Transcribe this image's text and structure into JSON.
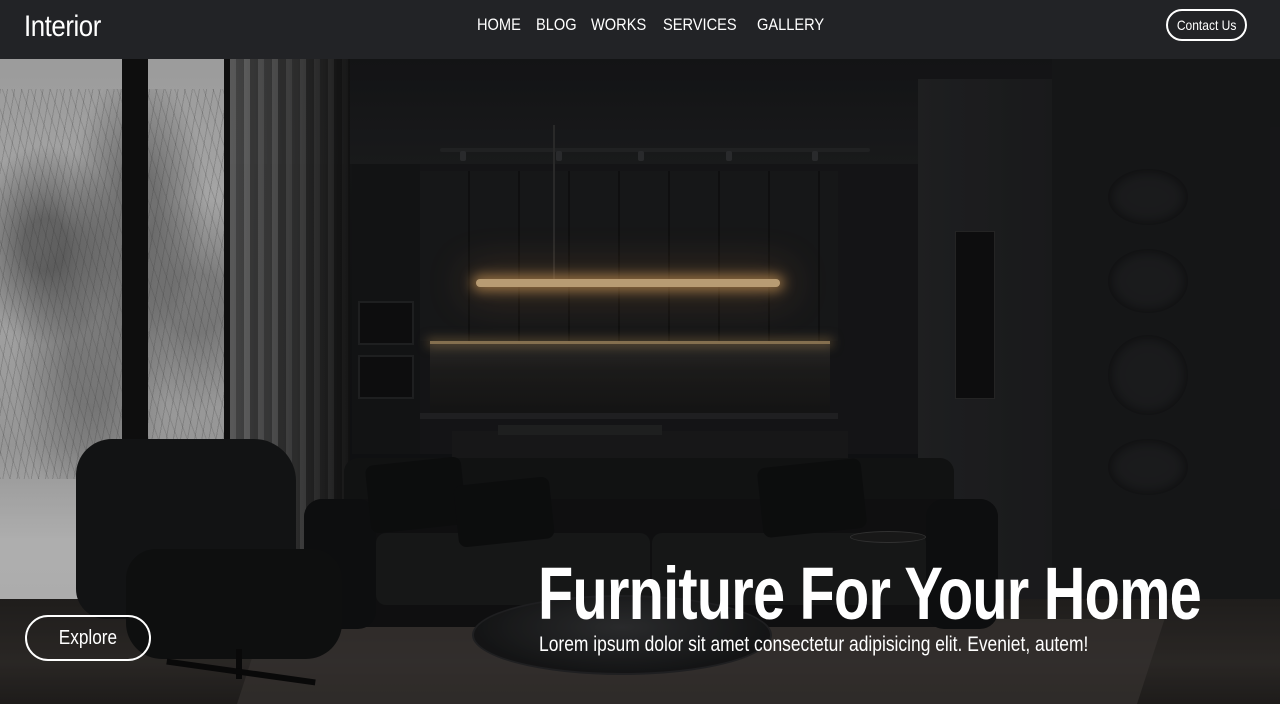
{
  "header": {
    "logo": "Interior",
    "nav": [
      "HOME",
      "BLOG",
      "WORKS",
      "SERVICES",
      "GALLERY"
    ],
    "contact_label": "Contact Us"
  },
  "hero": {
    "title": "Furniture For Your Home",
    "subtitle": "Lorem ipsum dolor sit amet consectetur adipisicing elit. Eveniet, autem!",
    "explore_label": "Explore",
    "image_description": "dark modern living room with black sofa, armchair, kitchen and snowy window"
  },
  "colors": {
    "header_bg": "#222326",
    "accent_light": "#ffd9a0",
    "text": "#ffffff"
  }
}
